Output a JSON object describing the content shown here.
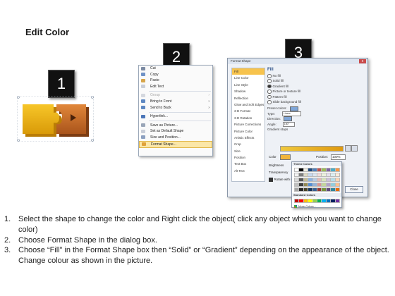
{
  "slide": {
    "title": "Edit Color"
  },
  "steps": [
    "1",
    "2",
    "3"
  ],
  "context_menu": {
    "items": [
      {
        "label": "Cut",
        "enabled": true,
        "icon": "scissors-icon"
      },
      {
        "label": "Copy",
        "enabled": true,
        "icon": "copy-icon"
      },
      {
        "label": "Paste",
        "enabled": true,
        "icon": "paste-icon"
      },
      {
        "label": "Edit Text",
        "enabled": true,
        "icon": "edit-text-icon"
      },
      {
        "label": "Group",
        "enabled": false,
        "icon": "group-icon",
        "submenu": true
      },
      {
        "label": "Bring to Front",
        "enabled": true,
        "icon": "bring-front-icon",
        "submenu": true
      },
      {
        "label": "Send to Back",
        "enabled": true,
        "icon": "send-back-icon",
        "submenu": true
      },
      {
        "label": "Hyperlink...",
        "enabled": true,
        "icon": "hyperlink-icon"
      },
      {
        "label": "Save as Picture...",
        "enabled": true,
        "icon": "save-picture-icon"
      },
      {
        "label": "Set as Default Shape",
        "enabled": true,
        "icon": "default-shape-icon"
      },
      {
        "label": "Size and Position...",
        "enabled": true,
        "icon": "size-position-icon"
      },
      {
        "label": "Format Shape...",
        "enabled": true,
        "icon": "format-shape-icon",
        "highlighted": true
      }
    ]
  },
  "format_dialog": {
    "title": "Format Shape",
    "close_label": "x",
    "categories": [
      "Fill",
      "Line Color",
      "Line Style",
      "Shadow",
      "Reflection",
      "Glow and Soft Edges",
      "3-D Format",
      "3-D Rotation",
      "Picture Corrections",
      "Picture Color",
      "Artistic Effects",
      "Crop",
      "Size",
      "Position",
      "Text Box",
      "Alt Text"
    ],
    "selected_category": "Fill",
    "fill_heading": "Fill",
    "fill_options": [
      "No fill",
      "Solid fill",
      "Gradient fill",
      "Picture or texture fill",
      "Pattern fill",
      "Slide background fill"
    ],
    "selected_fill": "Gradient fill",
    "fields": [
      {
        "label": "Preset colors:",
        "value": ""
      },
      {
        "label": "Type:",
        "value": "Linear"
      },
      {
        "label": "Direction:",
        "value": ""
      },
      {
        "label": "Angle:",
        "value": "180°"
      }
    ],
    "gradient_stops_label": "Gradient stops",
    "color_label": "Color",
    "position_label": "Position:",
    "position_value": "100%",
    "brightness_label": "Brightness",
    "transparency_label": "Transparency",
    "rotate_label": "Rotate with shape",
    "close_button": "Close"
  },
  "palette": {
    "theme_heading": "Theme Colors",
    "standard_heading": "Standard Colors",
    "more_label": "More Colors...",
    "theme_colors": [
      "#ffffff",
      "#000000",
      "#eeece1",
      "#1f497d",
      "#4f81bd",
      "#c0504d",
      "#9bbb59",
      "#8064a2",
      "#4bacc6",
      "#f79646",
      "#f2f2f2",
      "#7f7f7f",
      "#ddd9c3",
      "#c6d9f0",
      "#dbe5f1",
      "#f2dcdb",
      "#ebf1dd",
      "#e5e0ec",
      "#dbeef3",
      "#fdeada",
      "#d8d8d8",
      "#595959",
      "#c4bd97",
      "#8db3e2",
      "#b8cce4",
      "#e5b9b7",
      "#d7e3bc",
      "#ccc1d9",
      "#b7dde8",
      "#fbd5b5",
      "#bfbfbf",
      "#3f3f3f",
      "#938953",
      "#548dd4",
      "#95b3d7",
      "#d99694",
      "#c3d69b",
      "#b2a2c7",
      "#92cddc",
      "#fac08f",
      "#a5a5a5",
      "#262626",
      "#494429",
      "#17365d",
      "#366092",
      "#953734",
      "#76923c",
      "#5f497a",
      "#31859b",
      "#e36c09"
    ],
    "standard_colors": [
      "#c00000",
      "#ff0000",
      "#ffc000",
      "#ffff00",
      "#92d050",
      "#00b050",
      "#00b0f0",
      "#0070c0",
      "#002060",
      "#7030a0"
    ]
  },
  "instructions": [
    {
      "num": "1.",
      "text": "Select the shape to change the color and Right click the object( click any object which you want to change color)"
    },
    {
      "num": "2.",
      "text": "Choose Format Shape in the dialog box."
    },
    {
      "num": "3.",
      "text": "Choose “Fill” in the Format Shape box then “Solid” or “Gradient” depending on the appearance of the object. Change colour as shown in the picture."
    }
  ]
}
